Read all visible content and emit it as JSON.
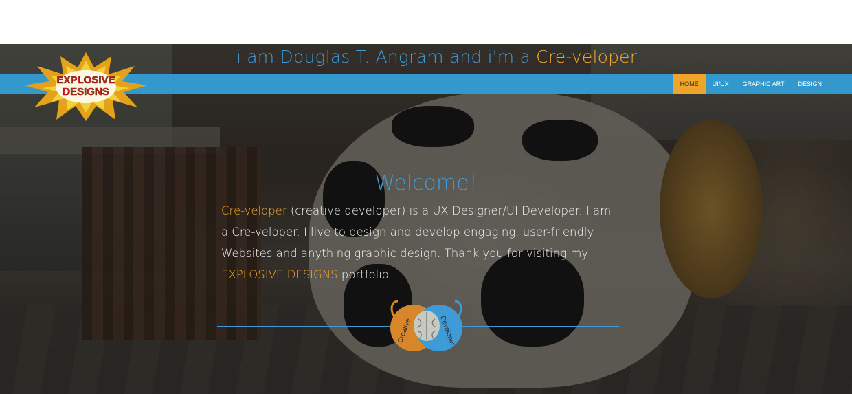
{
  "header": {
    "tagline_prefix": "i am Douglas T. Angram and i'm a",
    "tagline_accent": "Cre-veloper"
  },
  "logo": {
    "line1": "EXPLOSIVE",
    "line2": "DESIGNS"
  },
  "nav": {
    "items": [
      {
        "label": "HOME",
        "active": true
      },
      {
        "label": "UI/UX",
        "active": false
      },
      {
        "label": "GRAPHIC ART",
        "active": false
      },
      {
        "label": "DESIGN",
        "active": false
      }
    ]
  },
  "main": {
    "welcome_title": "Welcome!",
    "intro_accent_start": "Cre-veloper",
    "intro_text_1": "(creative developer) is a UX Designer/UI Developer. I am a Cre-veloper. I live to design and develop engaging, user-friendly Websites and anything graphic design. Thank you for visiting my",
    "intro_accent_end": "EXPLOSIVE DESIGNS",
    "intro_text_2": "portfolio."
  },
  "emblem": {
    "left_word": "Creative",
    "right_word": "Developer"
  },
  "colors": {
    "brand_blue": "#3399cc",
    "accent_orange": "#f0a52a",
    "text_blue": "#3f9bd6"
  }
}
